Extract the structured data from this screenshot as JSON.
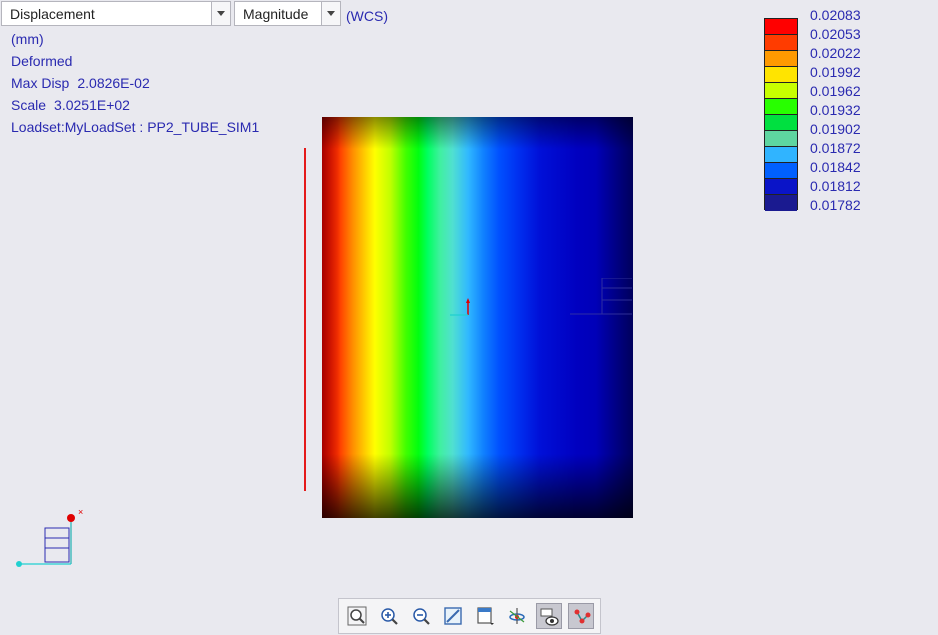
{
  "header": {
    "result_type": "Displacement",
    "component": "Magnitude",
    "coord_system": "(WCS)"
  },
  "info": {
    "units": "(mm)",
    "mode": "Deformed",
    "max_disp_label": "Max Disp",
    "max_disp_value": "2.0826E-02",
    "scale_label": "Scale",
    "scale_value": "3.0251E+02",
    "loadset": "Loadset:MyLoadSet :  PP2_TUBE_SIM1"
  },
  "legend": {
    "labels": [
      "0.02083",
      "0.02053",
      "0.02022",
      "0.01992",
      "0.01962",
      "0.01932",
      "0.01902",
      "0.01872",
      "0.01842",
      "0.01812",
      "0.01782"
    ],
    "colors": [
      "#ff0000",
      "#ff3c00",
      "#ff9a00",
      "#ffe400",
      "#c8ff00",
      "#28ff00",
      "#00e040",
      "#5ed6a0",
      "#30b4ff",
      "#0060ff",
      "#0a14c8",
      "#1a1a90"
    ]
  },
  "toolbar": {
    "tools": [
      "refit-icon",
      "zoom-in-icon",
      "zoom-out-icon",
      "repaint-icon",
      "saved-orientations-icon",
      "spin-center-icon",
      "display-style-icon",
      "datum-display-icon"
    ]
  },
  "colors": {
    "label_text": "#2a2ab0",
    "background": "#e9e9ef"
  }
}
